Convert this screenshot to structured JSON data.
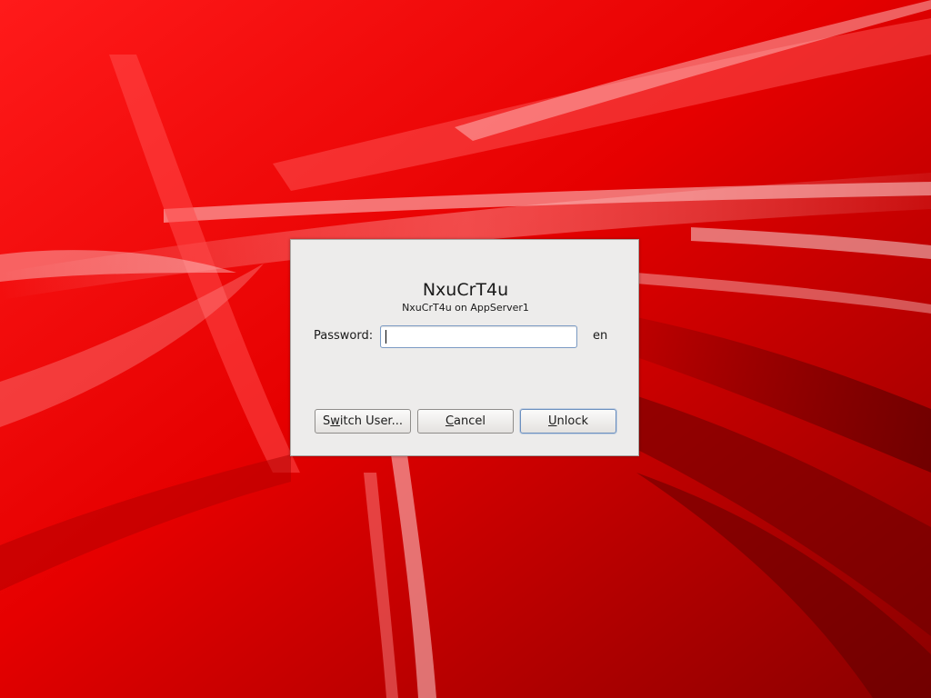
{
  "dialog": {
    "user_name": "NxuCrT4u",
    "user_host": "NxuCrT4u on AppServer1",
    "password_label": "Password:",
    "password_value": "",
    "layout_indicator": "en"
  },
  "buttons": {
    "switch_user": {
      "mnemonic_pre": "S",
      "mnemonic": "w",
      "rest": "itch User..."
    },
    "cancel": {
      "mnemonic_pre": "",
      "mnemonic": "C",
      "rest": "ancel"
    },
    "unlock": {
      "mnemonic_pre": "",
      "mnemonic": "U",
      "rest": "nlock"
    }
  },
  "colors": {
    "wallpaper_base": "#d40000",
    "dialog_bg": "#edeceb",
    "focus_border": "#7b9bc4"
  }
}
